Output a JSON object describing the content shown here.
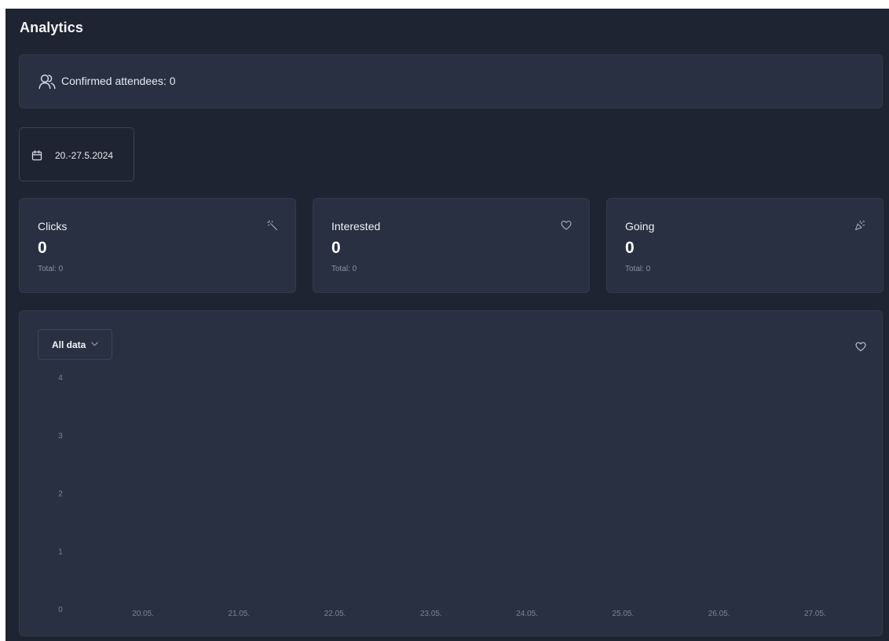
{
  "page": {
    "title": "Analytics"
  },
  "attendees": {
    "label": "Confirmed attendees: 0",
    "icon": "users-icon"
  },
  "date_range": {
    "label": "20.-27.5.2024",
    "icon": "calendar-icon"
  },
  "stats": [
    {
      "title": "Clicks",
      "value": "0",
      "total": "Total: 0",
      "icon": "magic-wand-icon"
    },
    {
      "title": "Interested",
      "value": "0",
      "total": "Total: 0",
      "icon": "heart-icon"
    },
    {
      "title": "Going",
      "value": "0",
      "total": "Total: 0",
      "icon": "party-popper-icon"
    }
  ],
  "chart_panel": {
    "filter_label": "All data",
    "filter_icon": "chevron-down-icon",
    "side_icon": "heart-icon"
  },
  "colors": {
    "background": "#1e2431",
    "card": "#283041",
    "muted_text": "#8a92a3",
    "text": "#e6e9ef"
  },
  "chart_data": {
    "type": "line",
    "title": "",
    "xlabel": "",
    "ylabel": "",
    "categories": [
      "20.05.",
      "21.05.",
      "22.05.",
      "23.05.",
      "24.05.",
      "25.05.",
      "26.05.",
      "27.05."
    ],
    "y_ticks": [
      "0",
      "1",
      "2",
      "3",
      "4"
    ],
    "ylim": [
      0,
      4
    ],
    "series": [
      {
        "values": [
          0,
          0,
          0,
          0,
          0,
          0,
          0,
          0
        ]
      }
    ],
    "grid": false
  }
}
